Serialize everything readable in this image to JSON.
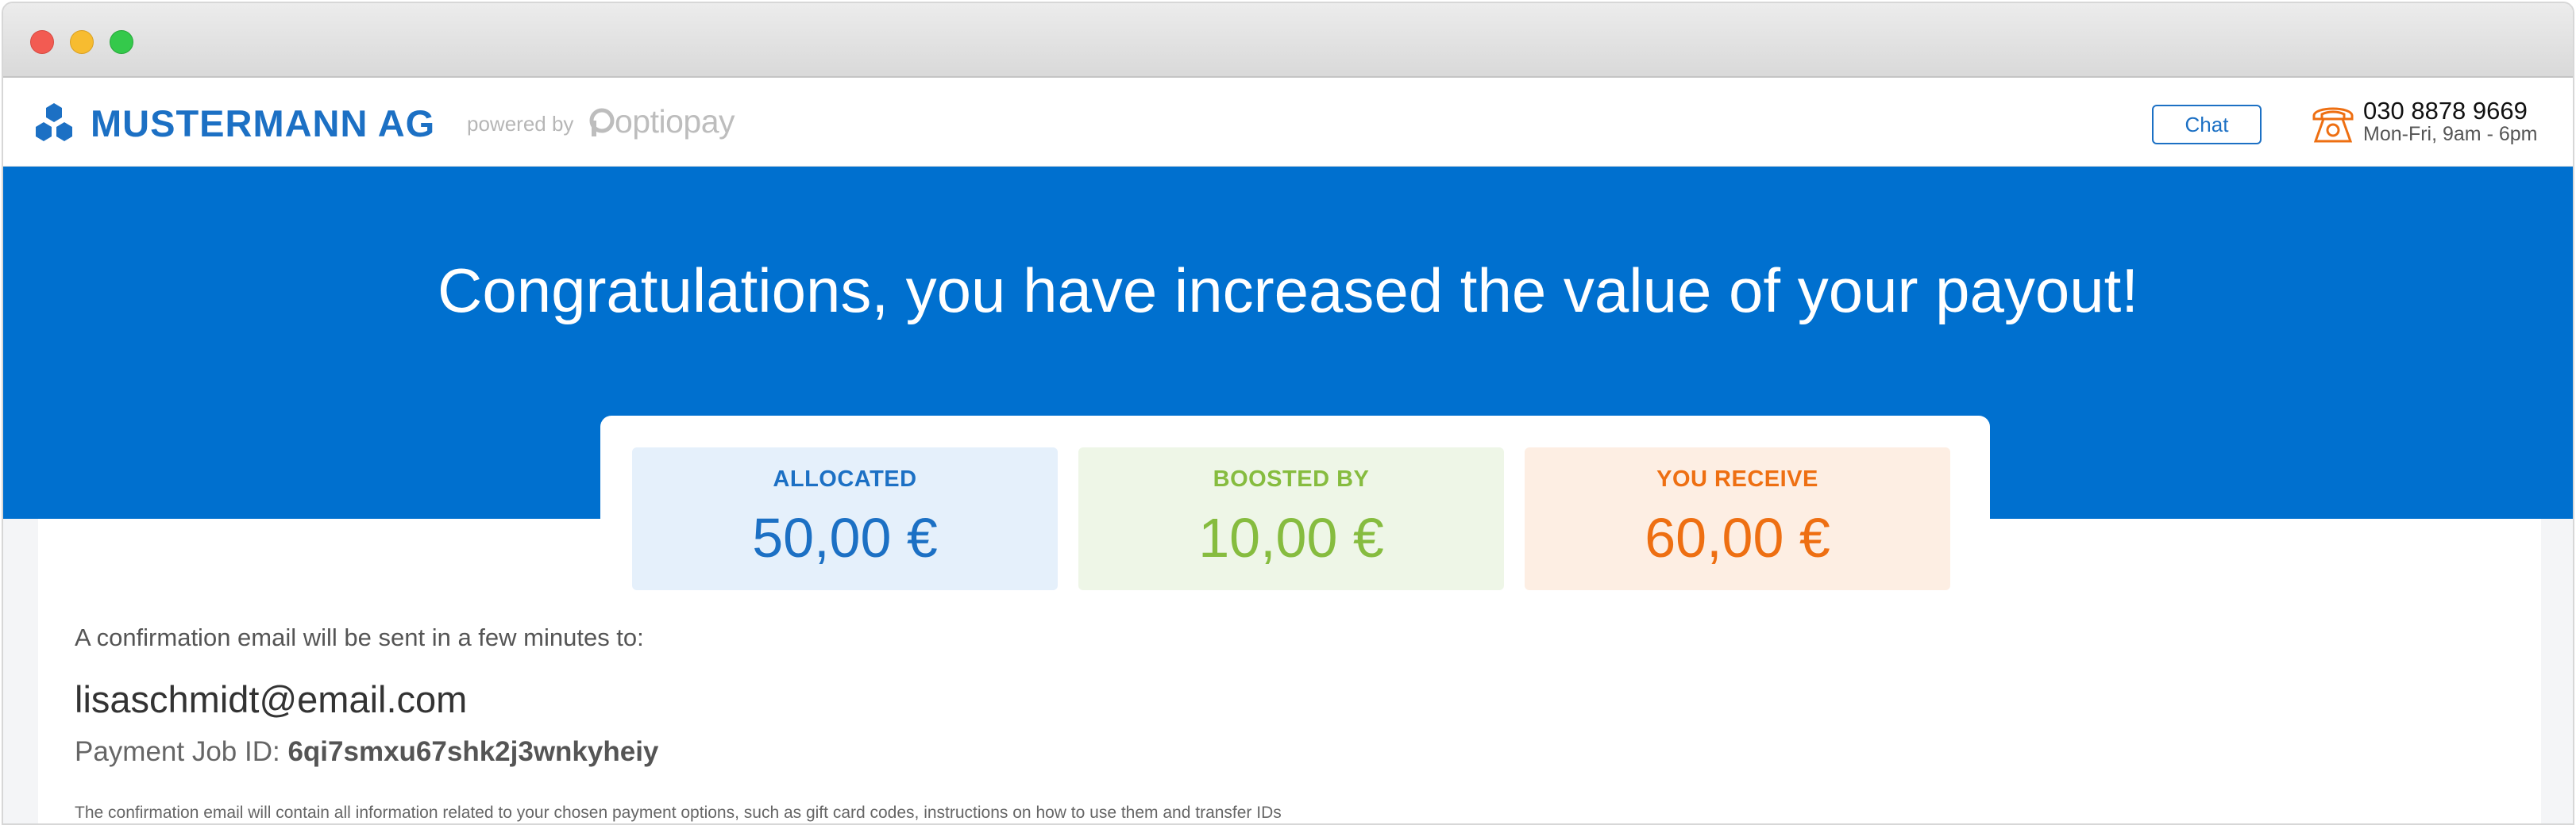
{
  "colors": {
    "brand_blue": "#1c70c4",
    "hero_blue": "#0070cf",
    "boost_green": "#86bc3f",
    "receive_orange": "#ee6f12"
  },
  "window": {
    "controls": [
      "close",
      "minimize",
      "zoom"
    ]
  },
  "header": {
    "brand": "MUSTERMANN AG",
    "logo_icon": "hexagon-cluster-icon",
    "powered_by": "powered by",
    "partner_name": "optiopay",
    "chat_label": "Chat",
    "phone_icon": "telephone-icon",
    "phone_number": "030 8878 9669",
    "phone_hours": "Mon-Fri, 9am - 6pm"
  },
  "hero": {
    "headline": "Congratulations, you have increased the value of your payout!"
  },
  "summary": {
    "allocated": {
      "label": "ALLOCATED",
      "value": "50,00 €"
    },
    "boosted": {
      "label": "BOOSTED BY",
      "value": "10,00 €"
    },
    "receive": {
      "label": "YOU RECEIVE",
      "value": "60,00 €"
    }
  },
  "confirmation": {
    "intro": "A confirmation email will be sent in a few minutes to:",
    "email": "lisaschmidt@email.com",
    "job_label": "Payment Job ID: ",
    "job_id": "6qi7smxu67shk2j3wnkyheiy",
    "footnote": "The confirmation email will contain all information related to your chosen payment options, such as gift card codes, instructions on how to use them and transfer IDs"
  }
}
